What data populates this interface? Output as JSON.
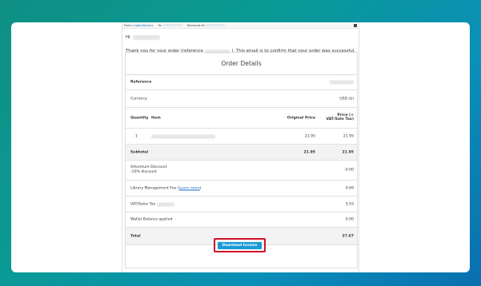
{
  "email_header": {
    "from_label": "From:",
    "from_value": "mightyfactory",
    "to_label": "To:",
    "received_label": "Received At:"
  },
  "greeting": "Hi",
  "intro_before": "Thank you for your order (reference",
  "intro_after": "). This email is to confirm that your order was successful.",
  "order_details": {
    "title": "Order Details",
    "reference_label": "Reference",
    "currency_label": "Currency",
    "currency_value": "USD ($)",
    "columns": {
      "quantity": "Quantity",
      "item": "Item",
      "original_price": "Original Price",
      "price_vat": "Price (+ VAT/Sale Tax)"
    },
    "line_item": {
      "quantity": "1",
      "original_price": "21.95",
      "price": "21.95"
    },
    "subtotal": {
      "label": "Subtotal",
      "original_price": "21.95",
      "price": "21.95"
    },
    "discount": {
      "label": "Adventure Discount",
      "sublabel": "-10% discount",
      "value": "-0.00"
    },
    "library_fee": {
      "label": "Library Management Fee",
      "link": "Learn more",
      "value": "0.69"
    },
    "vat": {
      "label": "VAT/Sales Tax",
      "value": "5.03"
    },
    "wallet": {
      "label": "Wallet Balance applied",
      "value": "0.00"
    },
    "total": {
      "label": "Total",
      "value": "27.67"
    },
    "download_button": "Download Invoice"
  },
  "colors": {
    "button": "#1a9ad6",
    "highlight": "#d0112b",
    "background_gradient_start": "#0f8f84",
    "background_gradient_end": "#0a6fb0"
  }
}
